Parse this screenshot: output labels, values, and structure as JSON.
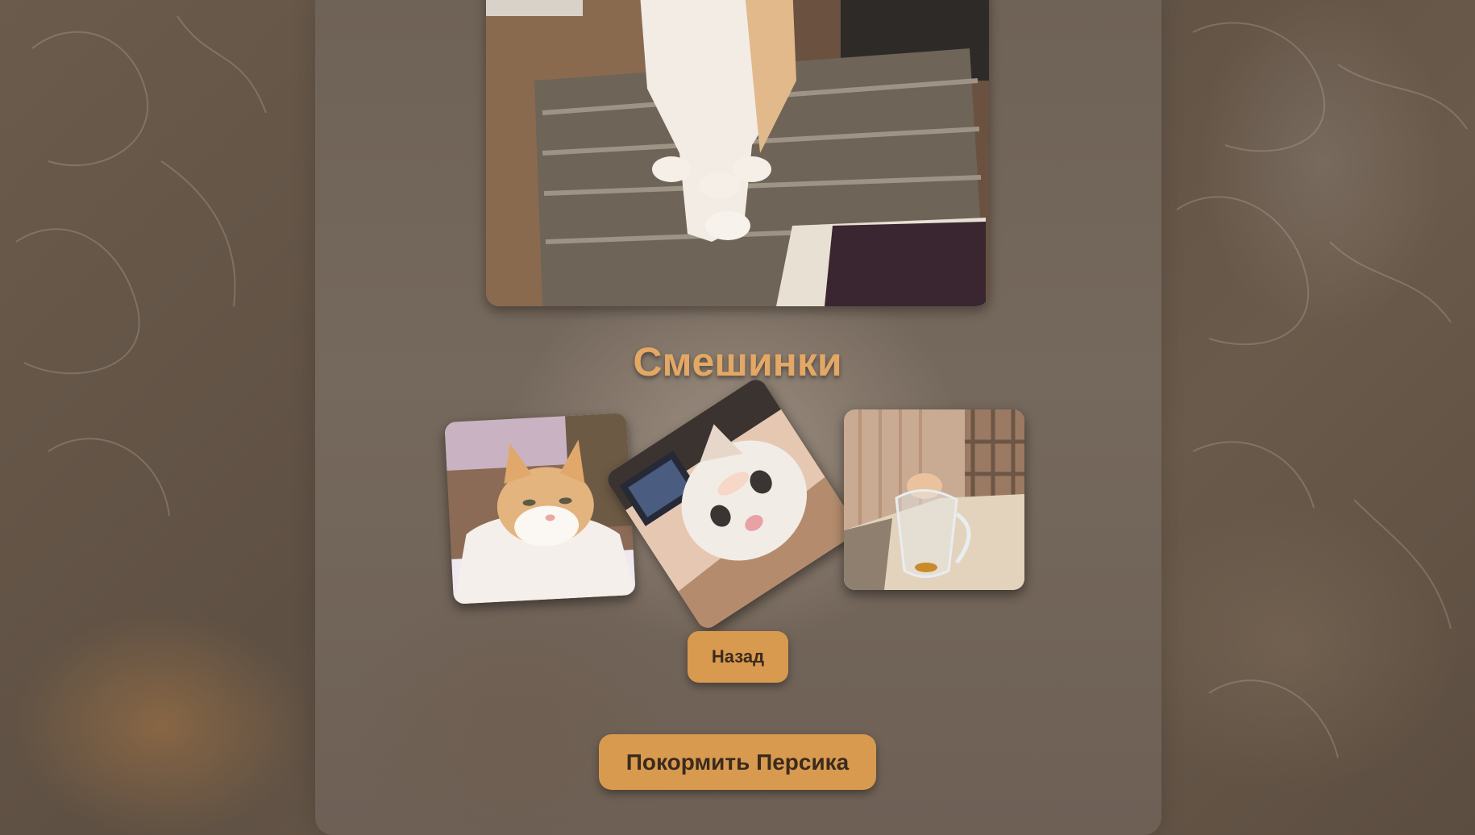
{
  "section": {
    "title": "Смешинки"
  },
  "gallery": {
    "images": [
      {
        "name": "cat-lying-photo"
      },
      {
        "name": "cat-closeup-photo"
      },
      {
        "name": "cat-glass-photo"
      }
    ]
  },
  "buttons": {
    "back_label": "Назад",
    "feed_label": "Покормить Персика"
  },
  "colors": {
    "accent": "#e3a865",
    "button": "#d89a4f",
    "button_text": "#3b2a1d"
  }
}
